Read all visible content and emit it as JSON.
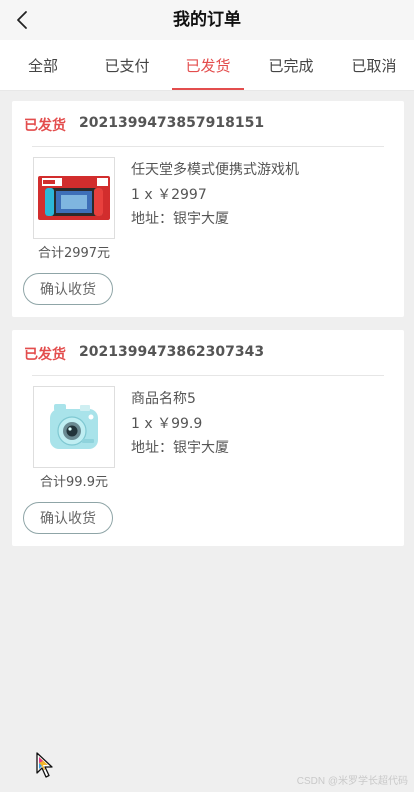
{
  "header": {
    "title": "我的订单",
    "back_icon": "chevron-left-icon"
  },
  "tabs": [
    {
      "label": "全部",
      "active": false
    },
    {
      "label": "已支付",
      "active": false
    },
    {
      "label": "已发货",
      "active": true
    },
    {
      "label": "已完成",
      "active": false
    },
    {
      "label": "已取消",
      "active": false
    }
  ],
  "orders": [
    {
      "status": "已发货",
      "order_no": "2021399473857918151",
      "product": {
        "name": "任天堂多模式便携式游戏机",
        "qty_price": "1 x ￥2997",
        "address": "地址：银宇大厦",
        "image": "game-console-image"
      },
      "total": "合计2997元",
      "action_label": "确认收货"
    },
    {
      "status": "已发货",
      "order_no": "2021399473862307343",
      "product": {
        "name": "商品名称5",
        "qty_price": "1 x ￥99.9",
        "address": "地址：银宇大厦",
        "image": "instant-camera-image"
      },
      "total": "合计99.9元",
      "action_label": "确认收货"
    }
  ],
  "watermark": "CSDN @米罗学长超代码",
  "colors": {
    "accent": "#e34d4d",
    "background": "#efefef",
    "button_border": "#8fa5a7"
  }
}
